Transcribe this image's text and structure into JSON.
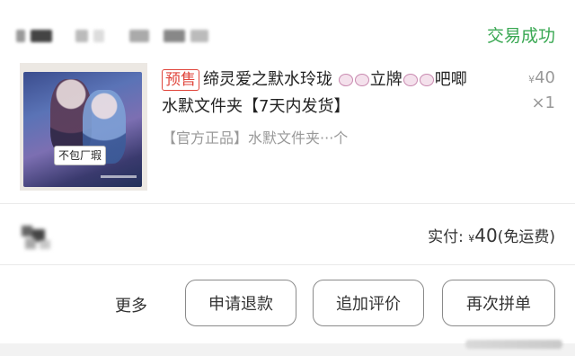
{
  "order": {
    "status": "交易成功",
    "status_color": "#3aa853",
    "product": {
      "presale_tag": "预售",
      "title_part1": "缔灵爱之默水玲珑",
      "title_part2": "立牌",
      "title_part3": "吧唧",
      "title_line2": "水默文件夹【7天内发货】",
      "spec": "【官方正品】水默文件夹",
      "spec_suffix": "···个",
      "badge": "不包厂瑕",
      "price_symbol": "¥",
      "price": "40",
      "qty": "×1"
    },
    "payment": {
      "label": "实付:",
      "currency": "¥",
      "amount": "40",
      "shipping_note": "(免运费)"
    },
    "actions": {
      "more": "更多",
      "refund": "申请退款",
      "review": "追加评价",
      "reorder": "再次拼单"
    }
  },
  "colors": {
    "presale": "#e0463c",
    "muted": "#999999",
    "text": "#222222"
  },
  "icons": [
    "emoji-face-icon",
    "shop-avatar-icon"
  ]
}
